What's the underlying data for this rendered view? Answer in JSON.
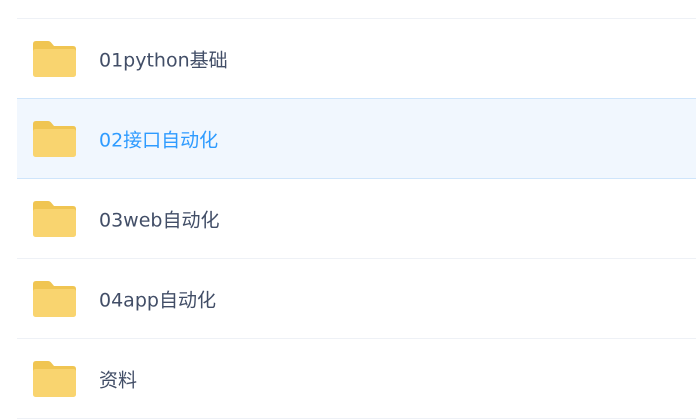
{
  "file_list": {
    "items": [
      {
        "name": "01python基础",
        "icon": "folder-icon",
        "selected": false
      },
      {
        "name": "02接口自动化",
        "icon": "folder-icon",
        "selected": true
      },
      {
        "name": "03web自动化",
        "icon": "folder-icon",
        "selected": false
      },
      {
        "name": "04app自动化",
        "icon": "folder-icon",
        "selected": false
      },
      {
        "name": "资料",
        "icon": "folder-icon",
        "selected": false
      }
    ]
  },
  "colors": {
    "folder": "#f9d46f",
    "folder_back": "#f0c552",
    "text": "#424e67",
    "selected_text": "#2e9bff",
    "selected_bg": "#f1f7fe",
    "selected_border": "#cfe5fb",
    "divider": "#eef1f6"
  }
}
